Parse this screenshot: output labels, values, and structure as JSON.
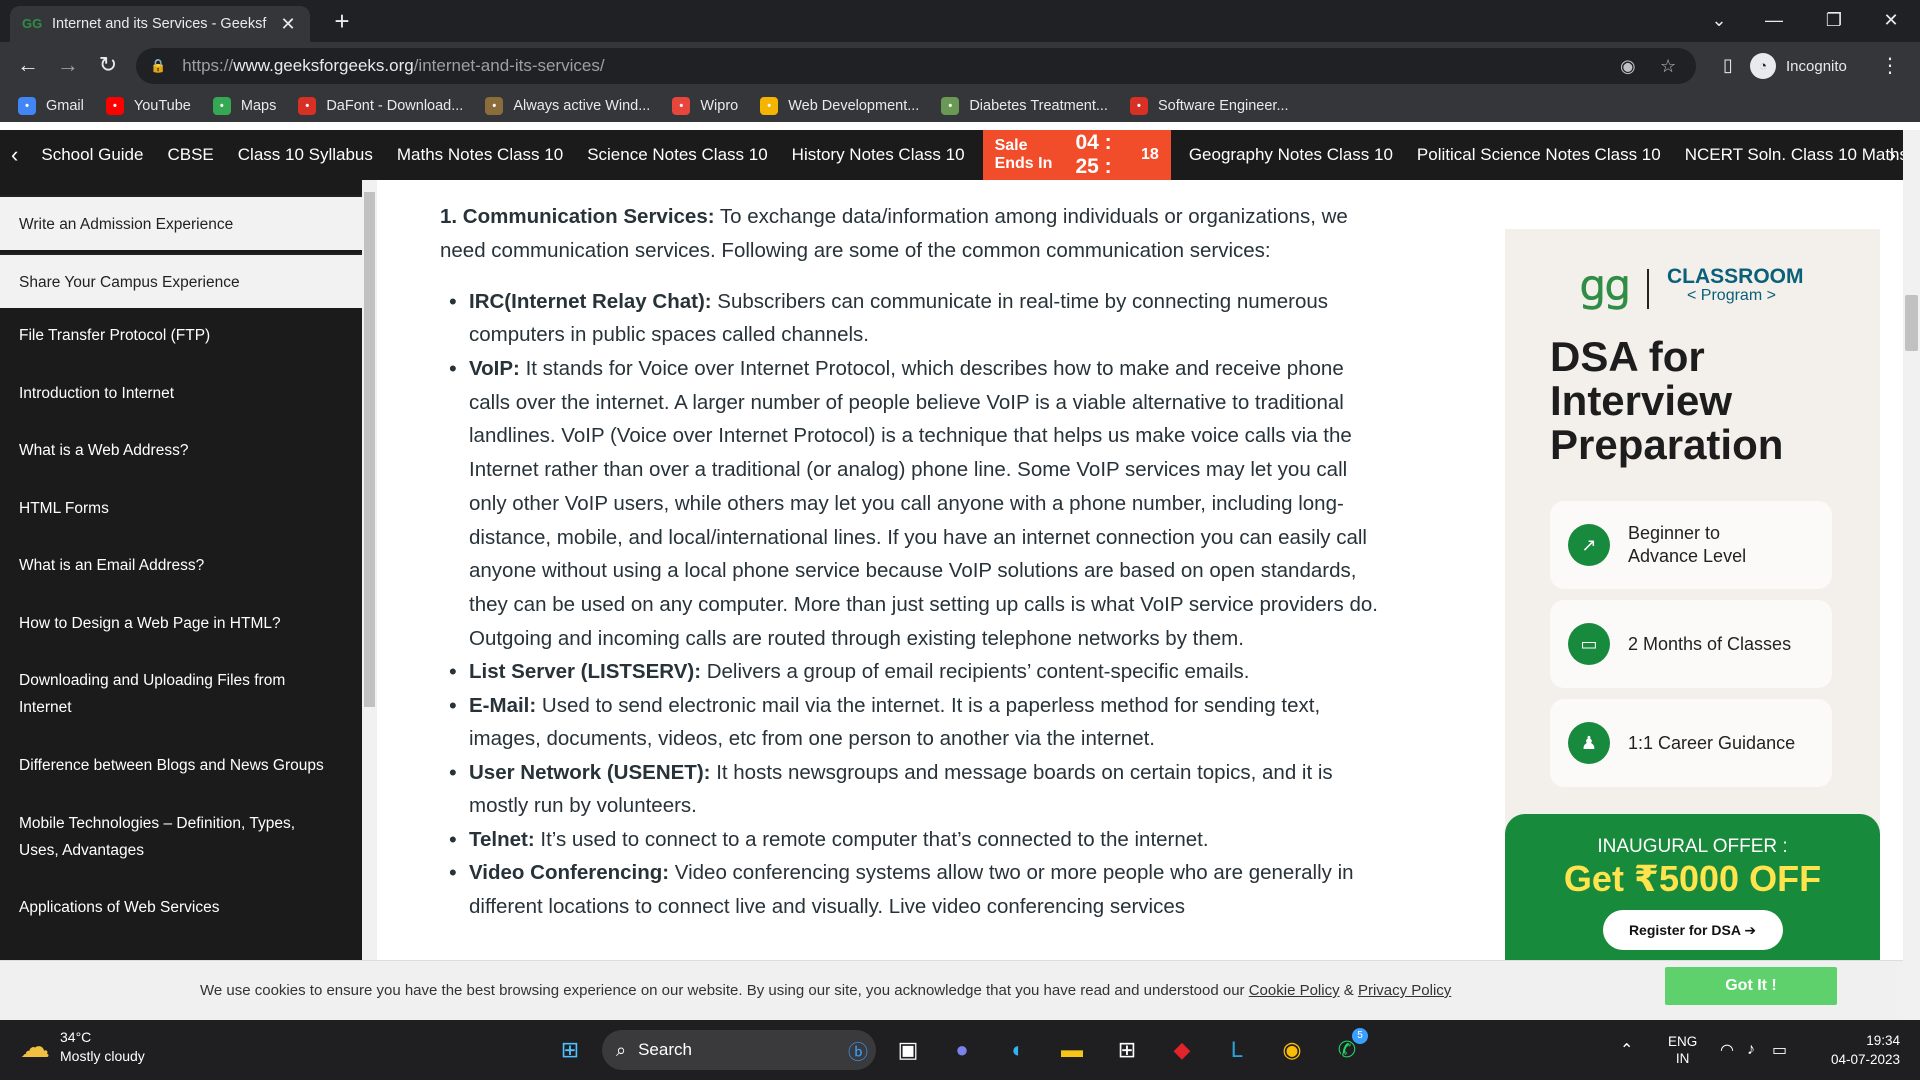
{
  "browser": {
    "tab_title": "Internet and its Services - Geeksf",
    "url_scheme": "https://",
    "url_host": "www.geeksforgeeks.org",
    "url_path": "/internet-and-its-services/",
    "incognito_label": "Incognito",
    "bookmarks": [
      {
        "label": "Gmail",
        "icon": "google-icon",
        "color": "#4285f4"
      },
      {
        "label": "YouTube",
        "icon": "youtube-icon",
        "color": "#ff0000"
      },
      {
        "label": "Maps",
        "icon": "maps-icon",
        "color": "#34a853"
      },
      {
        "label": "DaFont - Download...",
        "icon": "dafont-icon",
        "color": "#d93025"
      },
      {
        "label": "Always active Wind...",
        "icon": "site-icon",
        "color": "#8a6d3b"
      },
      {
        "label": "Wipro",
        "icon": "wipro-icon",
        "color": "#e8453c"
      },
      {
        "label": "Web Development...",
        "icon": "webdev-icon",
        "color": "#f4b400"
      },
      {
        "label": "Diabetes Treatment...",
        "icon": "diabetes-icon",
        "color": "#6a9955"
      },
      {
        "label": "Software Engineer...",
        "icon": "software-icon",
        "color": "#d93025"
      }
    ]
  },
  "subnav": {
    "items_left": [
      "School Guide",
      "CBSE",
      "Class 10 Syllabus",
      "Maths Notes Class 10",
      "Science Notes Class 10",
      "History Notes Class 10"
    ],
    "sale_label": "Sale Ends In",
    "sale_time": "04 : 25 :",
    "sale_seconds": "18",
    "items_right": [
      "Geography Notes Class 10",
      "Political Science Notes Class 10",
      "NCERT Soln. Class 10 Maths"
    ]
  },
  "sidebar": {
    "items": [
      "Write an Admission Experience",
      "Share Your Campus Experience",
      "File Transfer Protocol (FTP)",
      "Introduction to Internet",
      "What is a Web Address?",
      "HTML Forms",
      "What is an Email Address?",
      "How to Design a Web Page in HTML?",
      "Downloading and Uploading Files from Internet",
      "Difference between Blogs and News Groups",
      "Mobile Technologies – Definition, Types, Uses, Advantages",
      "Applications of Web Services"
    ]
  },
  "article": {
    "heading_bold": "1. Communication Services:",
    "heading_text": " To exchange data/information among individuals or organizations, we need communication services. Following are some of the common communication services:",
    "services": [
      {
        "name": "IRC(Internet Relay Chat):",
        "text": " Subscribers can communicate in real-time by connecting numerous computers in public spaces called channels."
      },
      {
        "name": "VoIP:",
        "text": " It stands for Voice over Internet Protocol, which describes how to make and receive phone calls over the internet. A larger number of people believe VoIP is a viable alternative to traditional landlines. VoIP (Voice over Internet Protocol) is a technique that helps us make voice calls via the Internet rather than over a traditional (or analog) phone line. Some VoIP services may let you call only other VoIP users, while others may let you call anyone with a phone number, including long-distance, mobile, and local/international lines. If you have an internet connection you can easily call anyone without using a local phone service because VoIP solutions are based on open standards, they can be used on any computer. More than just setting up calls is what VoIP service providers do. Outgoing and incoming calls are routed through existing telephone networks by them."
      },
      {
        "name": "List Server (LISTSERV):",
        "text": " Delivers a group of email recipients’ content-specific emails."
      },
      {
        "name": "E-Mail:",
        "text": " Used to send electronic mail via the internet. It is a paperless method for sending text, images, documents, videos, etc from one person to another via the internet."
      },
      {
        "name": "User Network (USENET):",
        "text": " It hosts newsgroups and message boards on certain topics, and it is mostly run by volunteers."
      },
      {
        "name": "Telnet:",
        "text": " It’s used to connect to a remote computer that’s connected to the internet."
      },
      {
        "name": "Video Conferencing:",
        "text": " Video conferencing systems allow two or more people who are generally in different locations to connect live and visually. Live video conferencing services"
      }
    ]
  },
  "ad": {
    "classroom": "CLASSROOM",
    "program": "< Program >",
    "title": "DSA for Interview Preparation",
    "features": [
      "Beginner to Advance Level",
      "2 Months of Classes",
      "1:1 Career Guidance"
    ],
    "offer_line1": "INAUGURAL OFFER :",
    "offer_line2": "Get ₹5000 OFF",
    "register": "Register for DSA ➔"
  },
  "cookie": {
    "text": "We use cookies to ensure you have the best browsing experience on our website. By using our site, you acknowledge that you have read and understood our",
    "policy1": "Cookie Policy",
    "amp": " & ",
    "policy2": "Privacy Policy",
    "button": "Got It !"
  },
  "taskbar": {
    "temp": "34°C",
    "weather": "Mostly cloudy",
    "search": "Search",
    "lang1": "ENG",
    "lang2": "IN",
    "time": "19:34",
    "date": "04-07-2023",
    "whatsapp_badge": "5"
  }
}
